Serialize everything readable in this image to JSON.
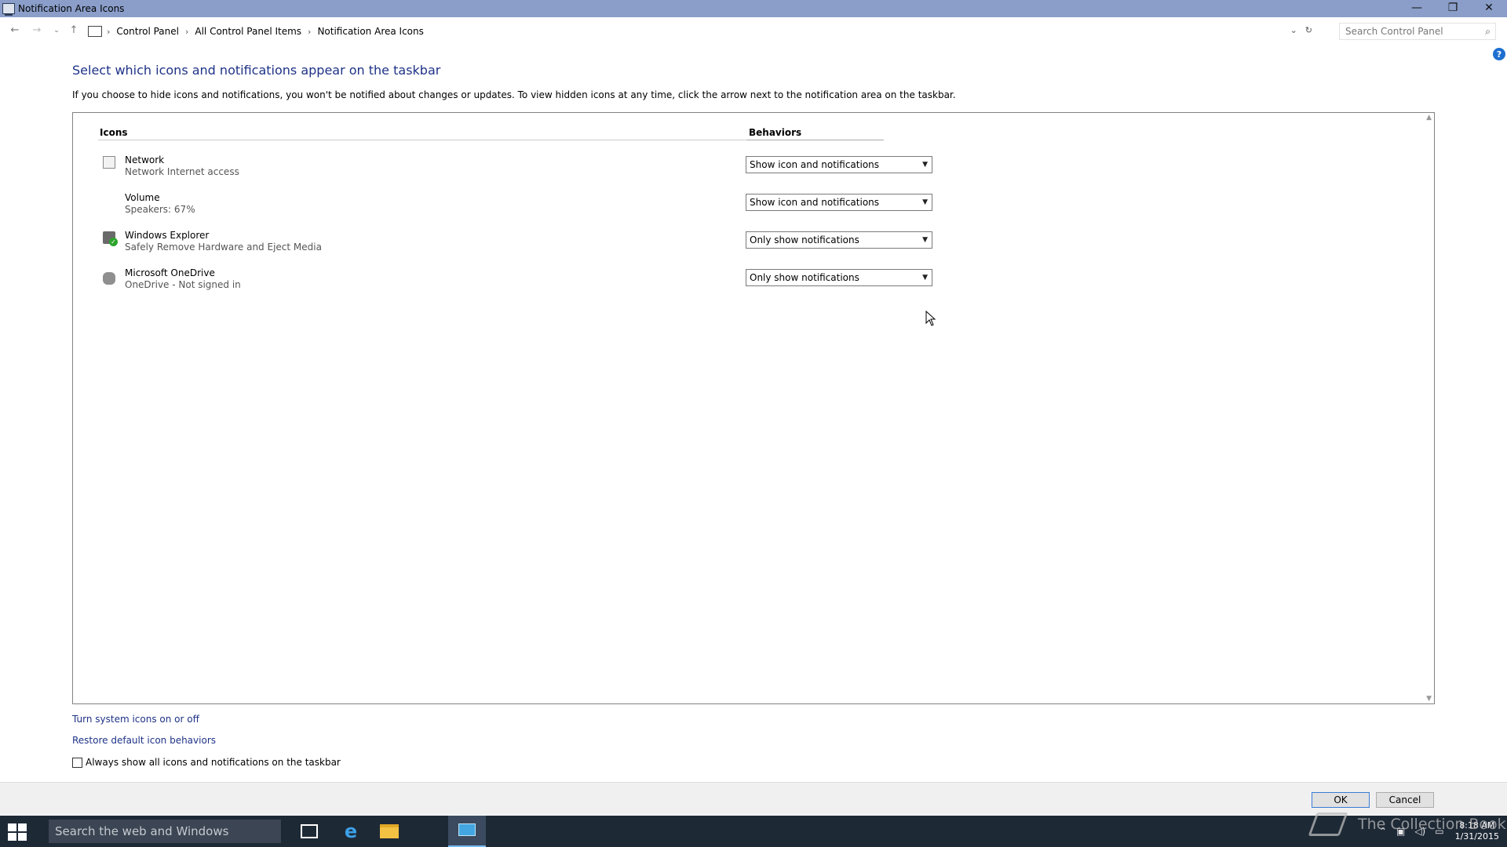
{
  "window": {
    "title": "Notification Area Icons",
    "minimize": "—",
    "restore": "❐",
    "close": "✕"
  },
  "address": {
    "crumbs": [
      "Control Panel",
      "All Control Panel Items",
      "Notification Area Icons"
    ],
    "search_placeholder": "Search Control Panel"
  },
  "page": {
    "heading": "Select which icons and notifications appear on the taskbar",
    "description": "If you choose to hide icons and notifications, you won't be notified about changes or updates. To view hidden icons at any time, click the arrow next to the notification area on the taskbar.",
    "help": "?"
  },
  "table": {
    "col_icons": "Icons",
    "col_behaviors": "Behaviors",
    "rows": [
      {
        "name": "Network",
        "sub": "Network Internet access",
        "behavior": "Show icon and notifications",
        "icon": "network-icon"
      },
      {
        "name": "Volume",
        "sub": "Speakers: 67%",
        "behavior": "Show icon and notifications",
        "icon": "volume-icon"
      },
      {
        "name": "Windows Explorer",
        "sub": "Safely Remove Hardware and Eject Media",
        "behavior": "Only show notifications",
        "icon": "usb-eject-icon"
      },
      {
        "name": "Microsoft OneDrive",
        "sub": "OneDrive - Not signed in",
        "behavior": "Only show notifications",
        "icon": "onedrive-cloud-icon"
      }
    ]
  },
  "links": {
    "turn_system_icons": "Turn system icons on or off",
    "restore_default": "Restore default icon behaviors"
  },
  "checkbox": {
    "label": "Always show all icons and notifications on the taskbar",
    "checked": false
  },
  "buttons": {
    "ok": "OK",
    "cancel": "Cancel"
  },
  "taskbar": {
    "search_placeholder": "Search the web and Windows",
    "time": "8:18 AM",
    "date": "1/31/2015"
  },
  "watermark": "The Collection Book",
  "colors": {
    "titlebar": "#8a9ec9",
    "link": "#1e3287",
    "taskbar": "#1e2936"
  }
}
